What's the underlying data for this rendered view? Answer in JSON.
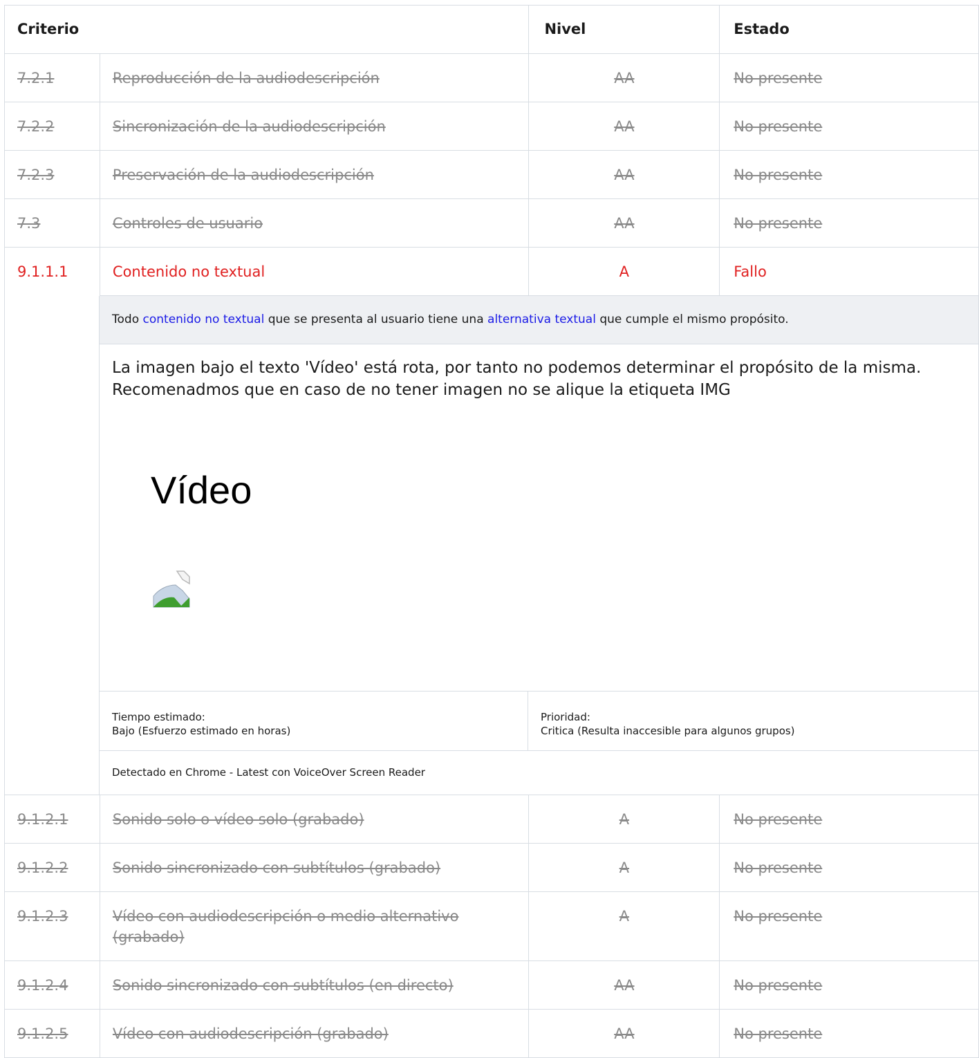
{
  "header": {
    "criterio": "Criterio",
    "nivel": "Nivel",
    "estado": "Estado"
  },
  "rows_before": [
    {
      "id": "7.2.1",
      "name": "Reproducción de la audiodescripción",
      "level": "AA",
      "status": "No presente"
    },
    {
      "id": "7.2.2",
      "name": "Sincronización de la audiodescripción",
      "level": "AA",
      "status": "No presente"
    },
    {
      "id": "7.2.3",
      "name": "Preservación de la audiodescripción",
      "level": "AA",
      "status": "No presente"
    },
    {
      "id": "7.3",
      "name": "Controles de usuario",
      "level": "AA",
      "status": "No presente"
    }
  ],
  "failed": {
    "id": "9.1.1.1",
    "name": "Contenido no textual",
    "level": "A",
    "status": "Fallo",
    "description": {
      "part1": "Todo ",
      "link1": "contenido no textual",
      "part2": " que se presenta al usuario tiene una ",
      "link2": "alternativa textual",
      "part3": " que cumple el mismo propósito."
    },
    "note": "La imagen bajo el texto 'Vídeo' está rota, por tanto no podemos determinar el propósito de la misma. Recomenadmos que en caso de no tener imagen no se alique la etiqueta IMG",
    "screenshot_text": "Vídeo",
    "broken_image_icon": "broken-image-icon",
    "time_label": "Tiempo estimado:",
    "time_value": "Bajo (Esfuerzo estimado en horas)",
    "priority_label": "Prioridad:",
    "priority_value": "Critica (Resulta inaccesible para algunos grupos)",
    "detected": "Detectado en Chrome - Latest con VoiceOver Screen Reader"
  },
  "rows_after": [
    {
      "id": "9.1.2.1",
      "name": "Sonido solo o vídeo solo (grabado)",
      "level": "A",
      "status": "No presente"
    },
    {
      "id": "9.1.2.2",
      "name": "Sonido sincronizado con subtítulos (grabado)",
      "level": "A",
      "status": "No presente"
    },
    {
      "id": "9.1.2.3",
      "name": "Vídeo con audiodescripción o medio alternativo (grabado)",
      "level": "A",
      "status": "No presente"
    },
    {
      "id": "9.1.2.4",
      "name": "Sonido sincronizado con subtítulos (en directo)",
      "level": "AA",
      "status": "No presente"
    },
    {
      "id": "9.1.2.5",
      "name": "Vídeo con audiodescripción (grabado)",
      "level": "AA",
      "status": "No presente"
    }
  ],
  "colors": {
    "fail": "#e02020",
    "link": "#1a1ae6",
    "muted": "#8a8a8a",
    "border": "#d8dde3",
    "desc_bg": "#eef0f3"
  }
}
